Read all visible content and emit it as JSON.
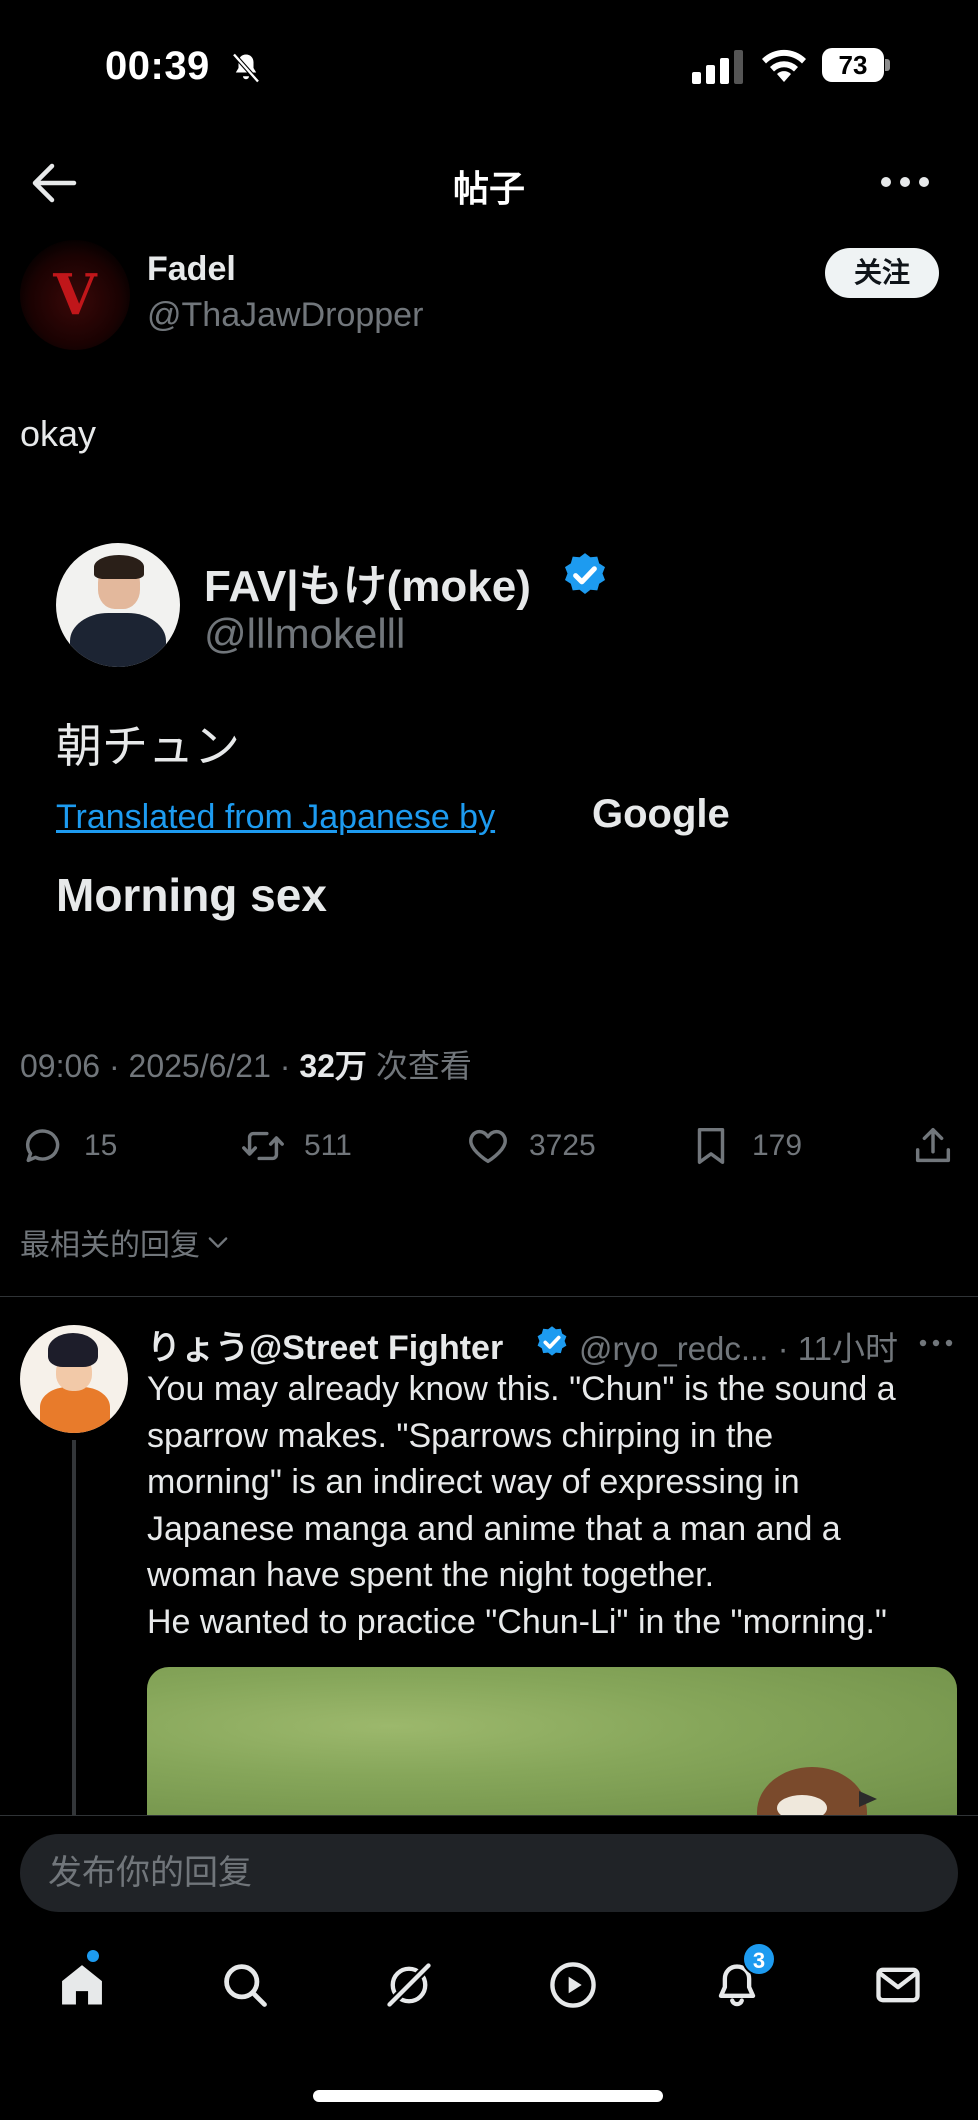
{
  "status_bar": {
    "time": "00:39",
    "battery": "73",
    "icons": [
      "bell-slash-icon",
      "cellular-signal-icon",
      "wifi-icon",
      "battery-icon"
    ]
  },
  "header": {
    "title": "帖子",
    "icons": [
      "back-arrow-icon",
      "more-icon"
    ]
  },
  "post": {
    "author_name": "Fadel",
    "author_handle": "@ThaJawDropper",
    "avatar_letter": "V",
    "follow_label": "关注",
    "text": "okay",
    "embedded": {
      "name": "FAV|もけ(moke)",
      "handle": "@lllmokelll",
      "text": "朝チュン",
      "translated_label": "Translated from Japanese by",
      "translator": "Google",
      "translation": "Morning sex"
    },
    "time": "09:06",
    "date": "2025/6/21",
    "views_count": "32万",
    "views_label": "次查看",
    "separator": " · ",
    "actions": {
      "replies": "15",
      "reposts": "511",
      "likes": "3725",
      "bookmarks": "179"
    }
  },
  "replies_section": {
    "sort_label": "最相关的回复"
  },
  "reply": {
    "name": "りょう@Street Fighter",
    "handle_time": "@ryo_redc... · 11小时",
    "lines": [
      "You may already know this. \"Chun\" is the sound a",
      "sparrow makes. \"Sparrows chirping in the",
      "morning\" is an indirect way of expressing in",
      "Japanese manga and anime that a man and a",
      "woman have spent the night together.",
      "He wanted to practice \"Chun-Li\" in the \"morning.\""
    ]
  },
  "composer": {
    "placeholder": "发布你的回复"
  },
  "tabbar": {
    "notifications_badge": "3",
    "icons": [
      "home-icon",
      "search-icon",
      "grok-icon",
      "video-icon",
      "notifications-icon",
      "messages-icon"
    ]
  },
  "colors": {
    "background": "#000000",
    "accent": "#1d9bf0",
    "secondary_text": "#71767b",
    "primary_text": "#e7e9ea"
  }
}
